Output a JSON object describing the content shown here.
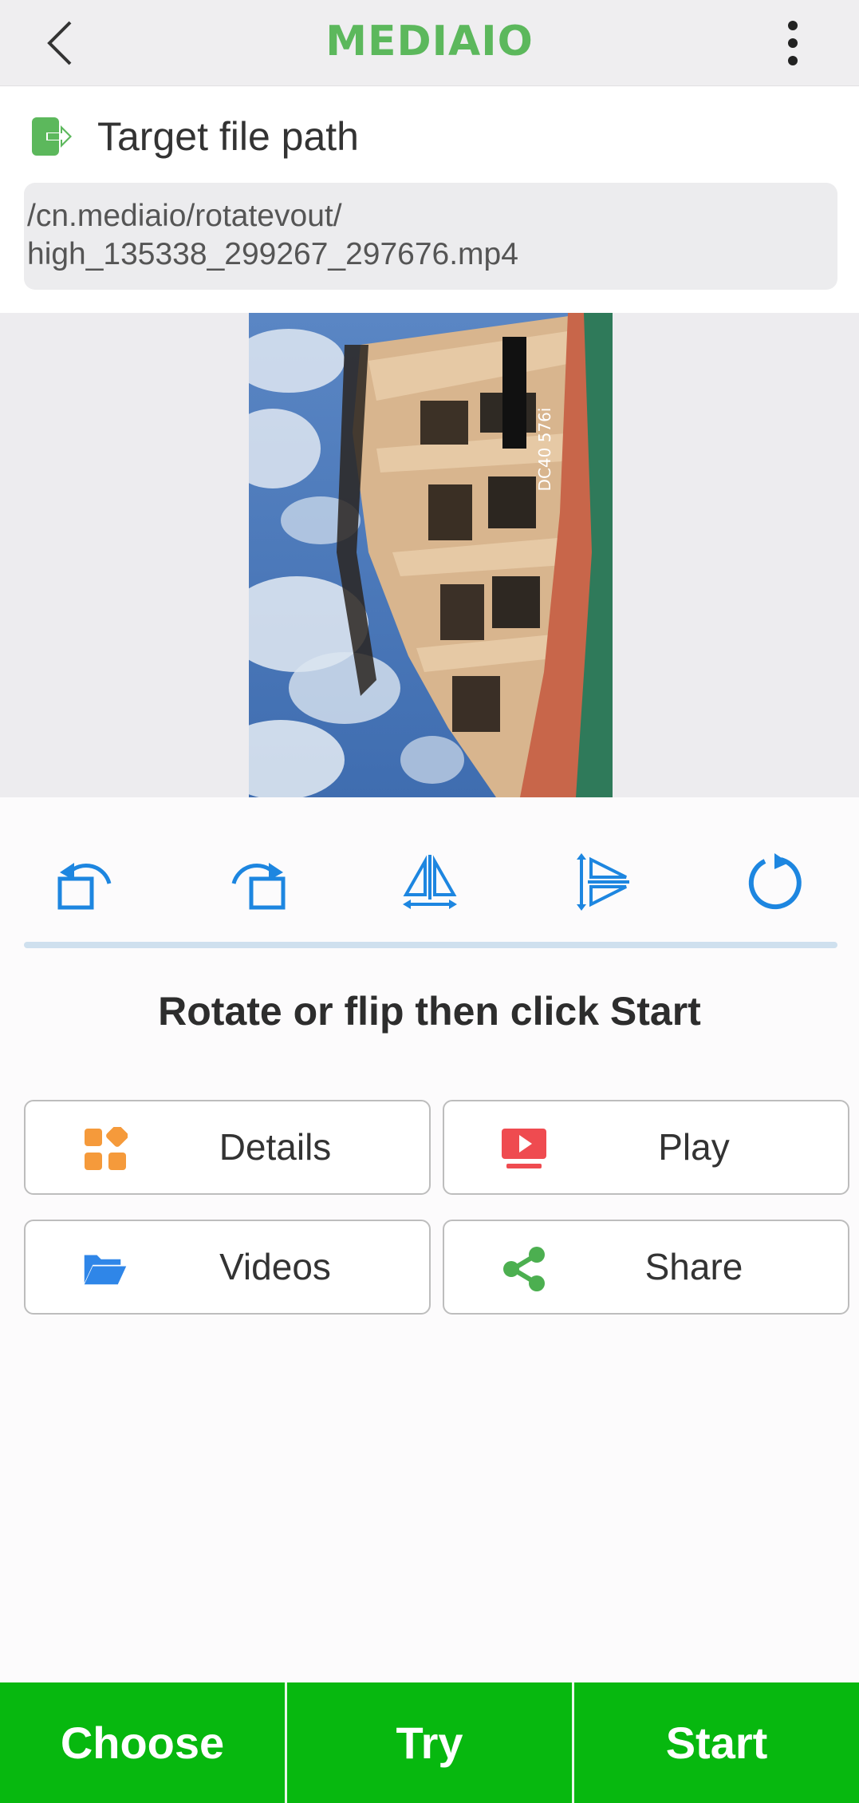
{
  "app": {
    "logo_text": "MEDIAIO",
    "brand_color": "#5cb85c"
  },
  "header": {
    "back_icon": "chevron-left-icon",
    "menu_icon": "more-vertical-icon"
  },
  "target": {
    "label": "Target file path",
    "icon": "file-export-icon",
    "path_line1": "/cn.mediaio/rotatevout/",
    "path_line2": "high_135338_299267_297676.mp4"
  },
  "preview": {
    "overlay_text": "DC40 576i"
  },
  "tools": [
    {
      "name": "rotate-left-icon"
    },
    {
      "name": "rotate-right-icon"
    },
    {
      "name": "flip-horizontal-icon"
    },
    {
      "name": "flip-vertical-icon"
    },
    {
      "name": "reset-rotation-icon"
    }
  ],
  "instruction": "Rotate or flip then click Start",
  "actions": {
    "details": {
      "label": "Details",
      "icon": "grid-icon",
      "color": "#f59a3b"
    },
    "play": {
      "label": "Play",
      "icon": "play-screen-icon",
      "color": "#ef4b50"
    },
    "videos": {
      "label": "Videos",
      "icon": "folder-open-icon",
      "color": "#2f86e8"
    },
    "share": {
      "label": "Share",
      "icon": "share-icon",
      "color": "#4caf50"
    }
  },
  "bottom": {
    "choose": "Choose",
    "try": "Try",
    "start": "Start",
    "color": "#07b80f"
  },
  "colors": {
    "tool_blue": "#1d86e0",
    "divider": "#cfe0ee"
  }
}
